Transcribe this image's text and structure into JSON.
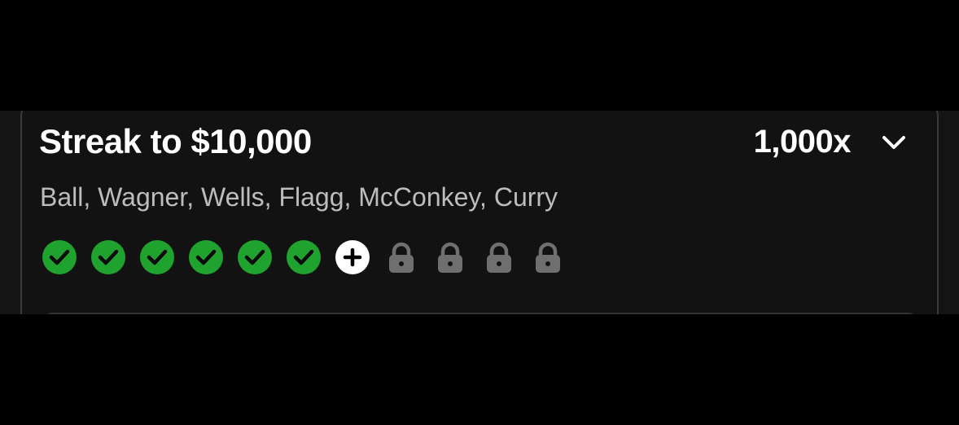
{
  "streak": {
    "title": "Streak to $10,000",
    "multiplier": "1,000x",
    "players": "Ball, Wagner, Wells, Flagg, McConkey, Curry",
    "expand_icon": "chevron-down-icon"
  },
  "progress": {
    "completed": 6,
    "current": 1,
    "locked": 4,
    "steps": [
      {
        "status": "completed",
        "icon": "check-icon"
      },
      {
        "status": "completed",
        "icon": "check-icon"
      },
      {
        "status": "completed",
        "icon": "check-icon"
      },
      {
        "status": "completed",
        "icon": "check-icon"
      },
      {
        "status": "completed",
        "icon": "check-icon"
      },
      {
        "status": "completed",
        "icon": "check-icon"
      },
      {
        "status": "current",
        "icon": "plus-icon"
      },
      {
        "status": "locked",
        "icon": "lock-icon"
      },
      {
        "status": "locked",
        "icon": "lock-icon"
      },
      {
        "status": "locked",
        "icon": "lock-icon"
      },
      {
        "status": "locked",
        "icon": "lock-icon"
      }
    ]
  },
  "colors": {
    "completed": "#1fa22e",
    "current": "#ffffff",
    "locked": "#6f6f6f",
    "text_primary": "#ffffff",
    "text_secondary": "#bdbdbd"
  }
}
